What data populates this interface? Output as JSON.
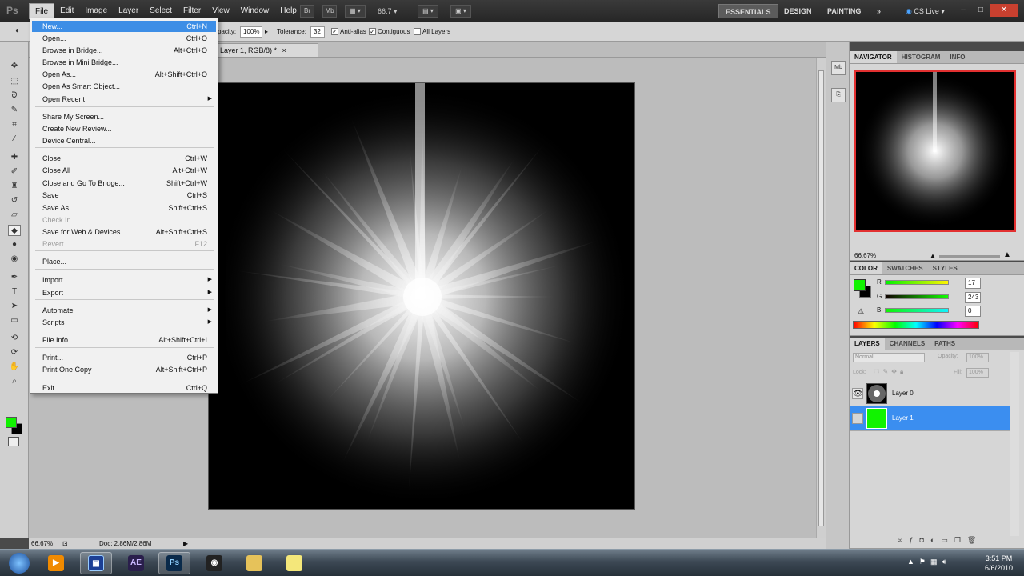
{
  "app": {
    "logo": "Ps",
    "menu": [
      "File",
      "Edit",
      "Image",
      "Layer",
      "Select",
      "Filter",
      "View",
      "Window",
      "Help"
    ],
    "bridge_btn": "Br",
    "mini_bridge_btn": "Mb",
    "zoom": "66.7",
    "workspaces": [
      "ESSENTIALS",
      "DESIGN",
      "PAINTING"
    ],
    "workspace_more": "»",
    "cs_live": "CS Live",
    "window_controls": [
      "–",
      "□",
      "✕"
    ]
  },
  "options_bar": {
    "opacity_label": "pacity:",
    "opacity_value": "100%",
    "tolerance_label": "Tolerance:",
    "tolerance_value": "32",
    "antialias_label": "Anti-alias",
    "contiguous_label": "Contiguous",
    "all_layers_label": "All Layers"
  },
  "document": {
    "tab_title": "Layer 1, RGB/8) *"
  },
  "status_bar": {
    "zoom": "66.67%",
    "doc_info": "Doc: 2.86M/2.86M"
  },
  "file_menu": {
    "items": [
      {
        "label": "New...",
        "shortcut": "Ctrl+N"
      },
      {
        "label": "Open...",
        "shortcut": "Ctrl+O"
      },
      {
        "label": "Browse in Bridge...",
        "shortcut": "Alt+Ctrl+O"
      },
      {
        "label": "Browse in Mini Bridge...",
        "shortcut": ""
      },
      {
        "label": "Open As...",
        "shortcut": "Alt+Shift+Ctrl+O"
      },
      {
        "label": "Open As Smart Object...",
        "shortcut": ""
      },
      {
        "label": "Open Recent",
        "shortcut": ""
      },
      {
        "label": "Share My Screen...",
        "shortcut": ""
      },
      {
        "label": "Create New Review...",
        "shortcut": ""
      },
      {
        "label": "Device Central...",
        "shortcut": ""
      },
      {
        "label": "Close",
        "shortcut": "Ctrl+W"
      },
      {
        "label": "Close All",
        "shortcut": "Alt+Ctrl+W"
      },
      {
        "label": "Close and Go To Bridge...",
        "shortcut": "Shift+Ctrl+W"
      },
      {
        "label": "Save",
        "shortcut": "Ctrl+S"
      },
      {
        "label": "Save As...",
        "shortcut": "Shift+Ctrl+S"
      },
      {
        "label": "Check In...",
        "shortcut": ""
      },
      {
        "label": "Save for Web & Devices...",
        "shortcut": "Alt+Shift+Ctrl+S"
      },
      {
        "label": "Revert",
        "shortcut": "F12"
      },
      {
        "label": "Place...",
        "shortcut": ""
      },
      {
        "label": "Import",
        "shortcut": ""
      },
      {
        "label": "Export",
        "shortcut": ""
      },
      {
        "label": "Automate",
        "shortcut": ""
      },
      {
        "label": "Scripts",
        "shortcut": ""
      },
      {
        "label": "File Info...",
        "shortcut": "Alt+Shift+Ctrl+I"
      },
      {
        "label": "Print...",
        "shortcut": "Ctrl+P"
      },
      {
        "label": "Print One Copy",
        "shortcut": "Alt+Shift+Ctrl+P"
      },
      {
        "label": "Exit",
        "shortcut": "Ctrl+Q"
      }
    ]
  },
  "navigator": {
    "tabs": [
      "NAVIGATOR",
      "HISTOGRAM",
      "INFO"
    ],
    "zoom": "66.67%"
  },
  "color_panel": {
    "tabs": [
      "COLOR",
      "SWATCHES",
      "STYLES"
    ],
    "r_label": "R",
    "g_label": "G",
    "b_label": "B",
    "r_value": "17",
    "g_value": "243",
    "b_value": "0",
    "foreground": "#11f300",
    "background": "#000000"
  },
  "layers_panel": {
    "tabs": [
      "LAYERS",
      "CHANNELS",
      "PATHS"
    ],
    "blend_mode": "Normal",
    "opacity_label": "Opacity:",
    "opacity": "100%",
    "lock_label": "Lock:",
    "fill_label": "Fill:",
    "fill": "100%",
    "layers": [
      {
        "name": "Layer 0"
      },
      {
        "name": "Layer 1"
      }
    ]
  },
  "taskbar": {
    "apps": [
      "start-orb",
      "media-player",
      "after-effects-alt",
      "after-effects",
      "photoshop",
      "camera",
      "folder",
      "sticky-notes"
    ],
    "ae_label": "AE",
    "ps_label": "Ps",
    "time": "3:51 PM",
    "date": "6/6/2010"
  }
}
